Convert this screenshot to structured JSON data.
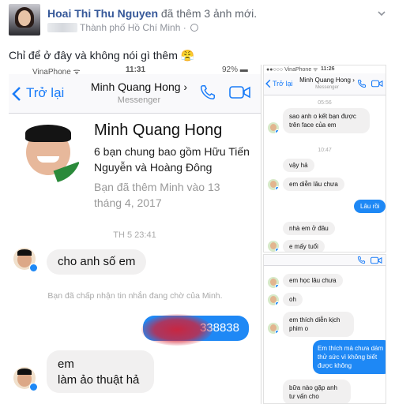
{
  "post": {
    "author": "Hoai Thi Thu Nguyen",
    "action": "đã thêm 3 ảnh mới.",
    "location": "Thành phố Hồ Chí Minh",
    "separator": "·",
    "caption": "Chỉ để ở đây và không nói gì thêm 😤"
  },
  "left_shot": {
    "status": {
      "carrier": "VinaPhone ᯤ",
      "time": "11:31",
      "battery": "92% ▬"
    },
    "nav": {
      "back": "Trở lại",
      "title": "Minh Quang Hong ›",
      "subtitle": "Messenger"
    },
    "profile": {
      "name": "Minh Quang Hong",
      "mutual": "6 bạn chung bao gồm Hữu Tiến Nguyễn và Hoàng Đông",
      "added": "Bạn đã thêm Minh vào 13 tháng 4, 2017"
    },
    "timestamp": "TH 5 23:41",
    "messages": [
      {
        "text": "cho anh số em"
      },
      {
        "text": "Bạn đã chấp nhận tin nhắn đang chờ của Minh."
      },
      {
        "text": "338838"
      },
      {
        "text": "em"
      },
      {
        "text": "làm ảo thuật hả"
      }
    ]
  },
  "right_top": {
    "status": {
      "carrier": "●●○○○ VinaPhone ᯤ",
      "time": "11:26"
    },
    "nav": {
      "back": "Trở lại",
      "title": "Minh Quang Hong ›",
      "subtitle": "Messenger"
    },
    "time1": "05:56",
    "msg1": "sao anh o kết bạn được trên face của em",
    "time2": "10:47",
    "msg2": "vậy hả",
    "msg3": "em diễn lâu chưa",
    "msg_out": "Lâu rồi",
    "msg4": "nhà em ở đâu",
    "msg5": "e mấy tuổi"
  },
  "right_bot": {
    "msg1": "em học lâu chưa",
    "msg2": "oh",
    "msg3": "em thích diễn kịch phim o",
    "msg_out": "Em thích mà chưa dám thử sức vì không biết được không",
    "msg4": "bữa nào gặp anh tư vấn cho"
  }
}
